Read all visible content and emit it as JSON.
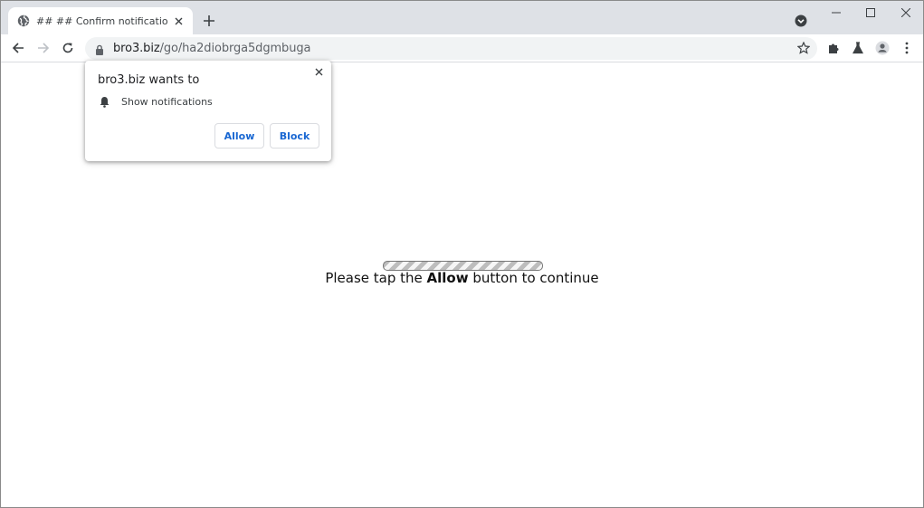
{
  "browser": {
    "tab": {
      "title": "## ## Confirm notifications ## #",
      "favicon": "globe-icon"
    },
    "new_tab_icon": "plus-icon",
    "window_controls": [
      "minimize-icon",
      "maximize-icon",
      "close-icon"
    ],
    "url": {
      "host": "bro3.biz",
      "path": "/go/ha2diobrga5dgmbuga"
    }
  },
  "popup": {
    "title": "bro3.biz wants to",
    "permission": "Show notifications",
    "allow_label": "Allow",
    "block_label": "Block"
  },
  "page": {
    "message_before": "Please tap the ",
    "message_bold": "Allow",
    "message_after": " button to continue"
  },
  "colors": {
    "tabstrip": "#dee1e6",
    "accent": "#1967d2",
    "omnibox": "#f1f3f4"
  }
}
